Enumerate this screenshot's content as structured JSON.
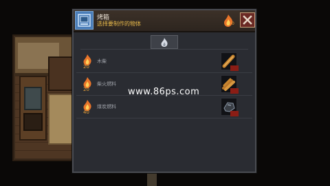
{
  "dialog": {
    "title": "烤箱",
    "subtitle": "选择要制作的物体",
    "fuel_count": "0",
    "close_icon": "close-icon"
  },
  "tab": {
    "icon": "flame-icon"
  },
  "recipes": [
    {
      "name": "木柴",
      "fuel": "20",
      "item_icon": "firewood-icon"
    },
    {
      "name": "柴火燃料",
      "fuel": "20",
      "item_icon": "kindling-icon"
    },
    {
      "name": "煤炭燃料",
      "fuel": "40",
      "item_icon": "coal-icon"
    }
  ],
  "watermark": "www.86ps.com",
  "colors": {
    "accent_orange": "#e6a03a",
    "header_blue": "#4a7db8",
    "close_red": "#6b2a24",
    "panel": "#2a2c32"
  }
}
